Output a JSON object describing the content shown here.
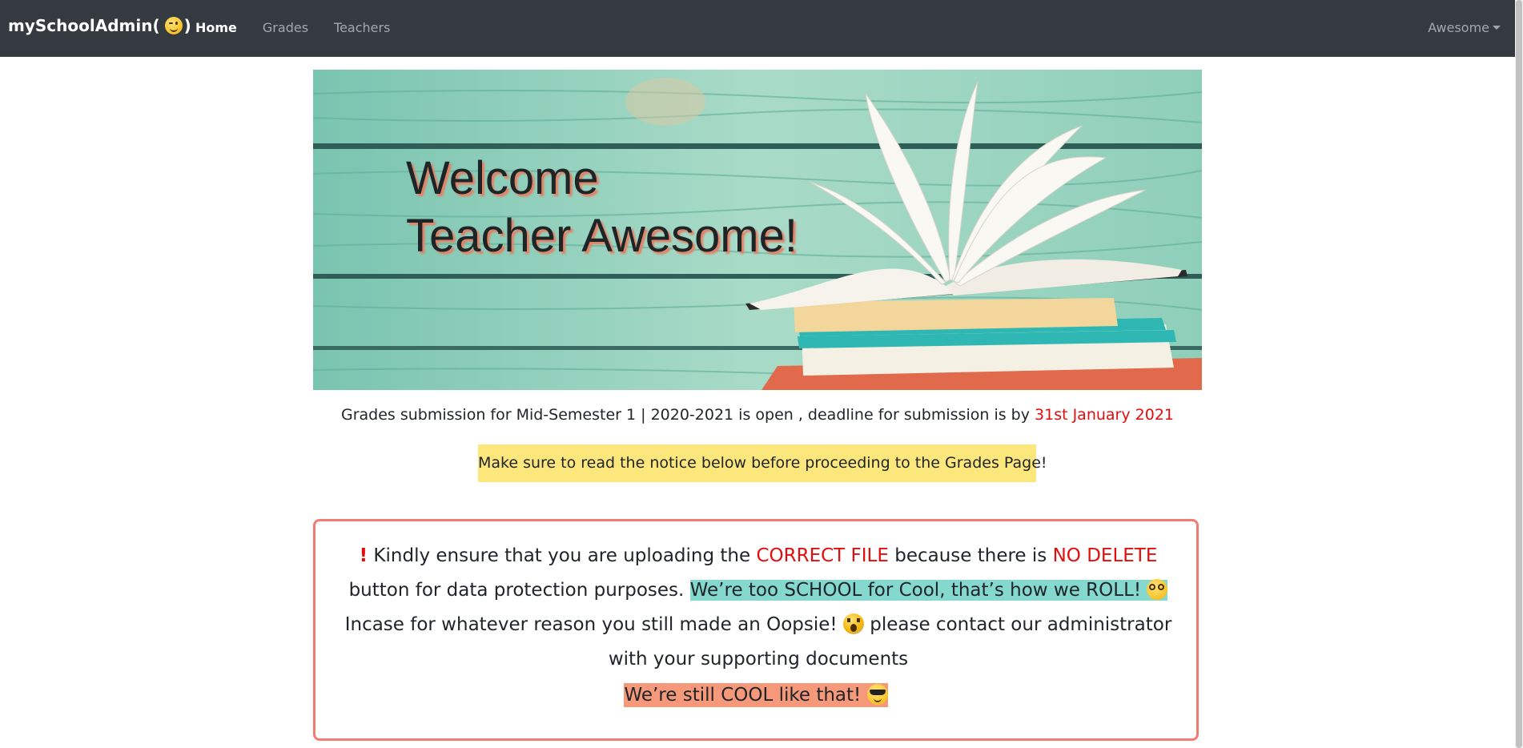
{
  "navbar": {
    "brand": "mySchoolAdmin(",
    "brand_suffix": ")",
    "brand_icon": "winking-face-icon",
    "links": [
      {
        "label": "Home",
        "active": true
      },
      {
        "label": "Grades",
        "active": false
      },
      {
        "label": "Teachers",
        "active": false
      }
    ],
    "user_menu": "Awesome"
  },
  "hero": {
    "line1": "Welcome",
    "line2": "Teacher Awesome!"
  },
  "announcement": {
    "text": "Grades submission for Mid-Semester 1 | 2020-2021 is open , deadline for submission is by",
    "deadline": "31st January 2021"
  },
  "yellow_note": "Make sure to read the notice below before proceeding to the Grades Page!",
  "notice": {
    "exclamation": "!",
    "part1": " Kindly ensure that you are uploading the ",
    "correct_file": "CORRECT FILE",
    "part2": " because there is ",
    "no_delete": "NO DELETE",
    "part3": " button for data protection purposes. ",
    "highlight": "We’re too SCHOOL for Cool, that’s how we ROLL!",
    "part4": " Incase for whatever reason you still made an Oopsie! ",
    "part5": " please contact our administrator with your supporting documents",
    "cool": "We’re still COOL like that!"
  },
  "colors": {
    "navbar_bg": "#343a40",
    "red_text": "#e20d0d",
    "yellow_note_bg": "#fce77d",
    "notice_border": "#f07c74",
    "teal_highlight": "#85d8ce",
    "orange_highlight": "#f5997a"
  }
}
